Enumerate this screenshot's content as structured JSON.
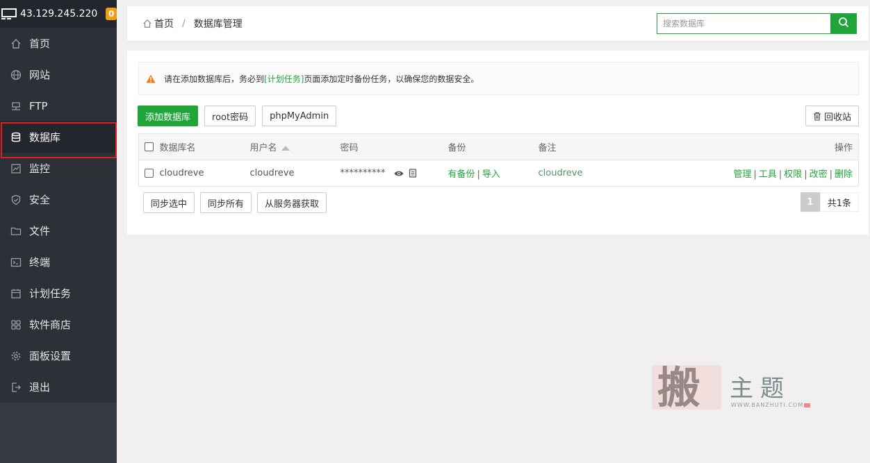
{
  "sidebar": {
    "server_ip": "43.129.245.220",
    "badge_count": "0",
    "items": [
      {
        "label": "首页",
        "icon": "home-icon"
      },
      {
        "label": "网站",
        "icon": "globe-icon"
      },
      {
        "label": "FTP",
        "icon": "ftp-icon"
      },
      {
        "label": "数据库",
        "icon": "database-icon"
      },
      {
        "label": "监控",
        "icon": "monitor-chart-icon"
      },
      {
        "label": "安全",
        "icon": "shield-icon"
      },
      {
        "label": "文件",
        "icon": "folder-icon"
      },
      {
        "label": "终端",
        "icon": "terminal-icon"
      },
      {
        "label": "计划任务",
        "icon": "calendar-icon"
      },
      {
        "label": "软件商店",
        "icon": "apps-icon"
      },
      {
        "label": "面板设置",
        "icon": "gear-icon"
      },
      {
        "label": "退出",
        "icon": "logout-icon"
      }
    ],
    "active_index": 3
  },
  "header": {
    "breadcrumb_home": "首页",
    "breadcrumb_sep": "/",
    "breadcrumb_current": "数据库管理",
    "search_placeholder": "搜索数据库"
  },
  "alert": {
    "text_before": "请在添加数据库后，务必到",
    "link": "[计划任务]",
    "text_after": "页面添加定时备份任务，以确保您的数据安全。"
  },
  "toolbar": {
    "add_db": "添加数据库",
    "root_pwd": "root密码",
    "phpmyadmin": "phpMyAdmin",
    "recycle": "回收站"
  },
  "table": {
    "headers": {
      "name": "数据库名",
      "user": "用户名",
      "password": "密码",
      "backup": "备份",
      "note": "备注",
      "ops": "操作"
    },
    "rows": [
      {
        "name": "cloudreve",
        "user": "cloudreve",
        "password": "**********",
        "backup_has": "有备份",
        "backup_import": "导入",
        "note": "cloudreve",
        "ops": [
          "管理",
          "工具",
          "权限",
          "改密",
          "删除"
        ]
      }
    ]
  },
  "bottom": {
    "sync_selected": "同步选中",
    "sync_all": "同步所有",
    "fetch_server": "从服务器获取",
    "page": "1",
    "total": "共1条"
  },
  "watermark": {
    "char": "搬",
    "title": "主题",
    "url": "WWW.BANZHUTI.COM"
  },
  "colors": {
    "accent": "#20a53a",
    "sidebar_bg": "#2c3138",
    "active_outline": "#e02020",
    "badge": "#f39c12"
  }
}
